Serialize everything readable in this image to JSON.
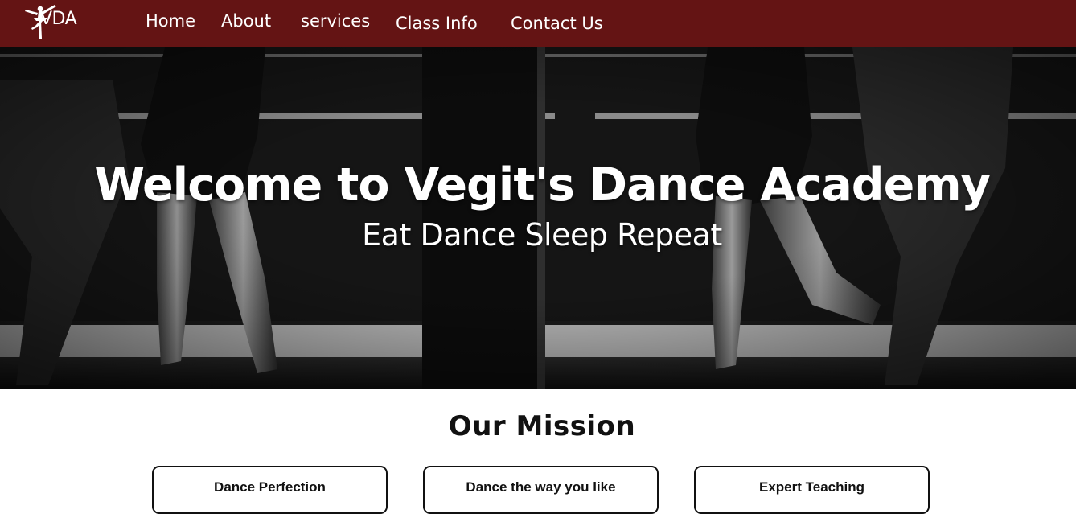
{
  "navbar": {
    "logo_icon": "ballerina-icon",
    "brand": "VDA",
    "links": [
      "Home",
      "About",
      "services",
      "Class Info",
      "Contact Us"
    ],
    "background": "#641414"
  },
  "hero": {
    "title": "Welcome to Vegit's Dance Academy",
    "subtitle": "Eat Dance Sleep Repeat"
  },
  "mission": {
    "heading": "Our  Mission",
    "cards": [
      "Dance Perfection",
      "Dance the way you like",
      "Expert Teaching"
    ]
  }
}
